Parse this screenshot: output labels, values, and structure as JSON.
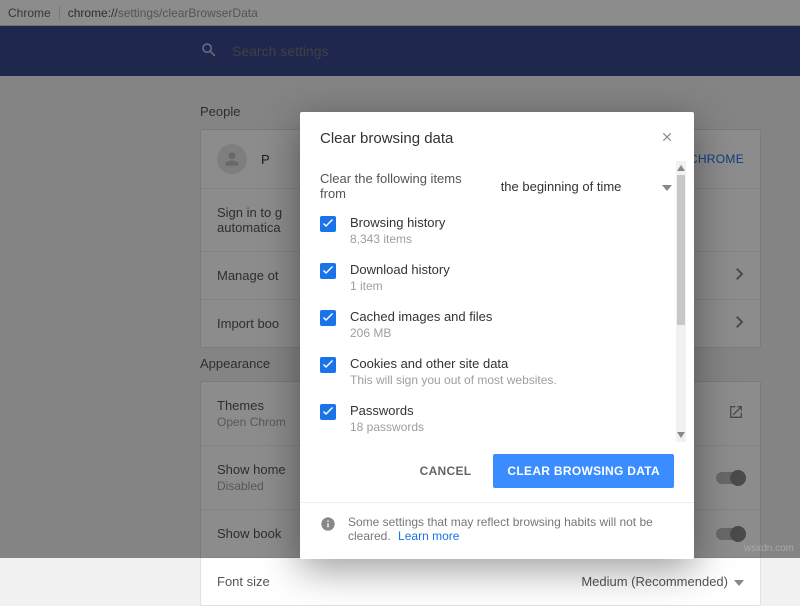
{
  "urlbar": {
    "brand": "Chrome",
    "scheme": "chrome://",
    "path": "settings/clearBrowserData"
  },
  "search": {
    "placeholder": "Search settings"
  },
  "sections": {
    "people": "People",
    "appearance": "Appearance"
  },
  "people": {
    "name_prefix": "P",
    "chrome_badge": "O CHROME",
    "rows": {
      "sign_in": {
        "line1": "Sign in to g",
        "line2": "automatica"
      },
      "manage": "Manage ot",
      "import": "Import boo"
    }
  },
  "appearance": {
    "themes": {
      "label": "Themes",
      "sub": "Open Chrom"
    },
    "show_home": {
      "label": "Show home",
      "sub": "Disabled"
    },
    "show_book": {
      "label": "Show book"
    },
    "font": {
      "label": "Font size",
      "value": "Medium (Recommended)"
    }
  },
  "dialog": {
    "title": "Clear browsing data",
    "range_label": "Clear the following items from",
    "range_value": "the beginning of time",
    "options": [
      {
        "label": "Browsing history",
        "sub": "8,343 items"
      },
      {
        "label": "Download history",
        "sub": "1 item"
      },
      {
        "label": "Cached images and files",
        "sub": "206 MB"
      },
      {
        "label": "Cookies and other site data",
        "sub": "This will sign you out of most websites."
      },
      {
        "label": "Passwords",
        "sub": "18 passwords"
      }
    ],
    "cancel": "CANCEL",
    "confirm": "CLEAR BROWSING DATA",
    "footer": "Some settings that may reflect browsing habits will not be cleared.",
    "learn_more": "Learn more"
  },
  "watermark": "wsxdn.com"
}
